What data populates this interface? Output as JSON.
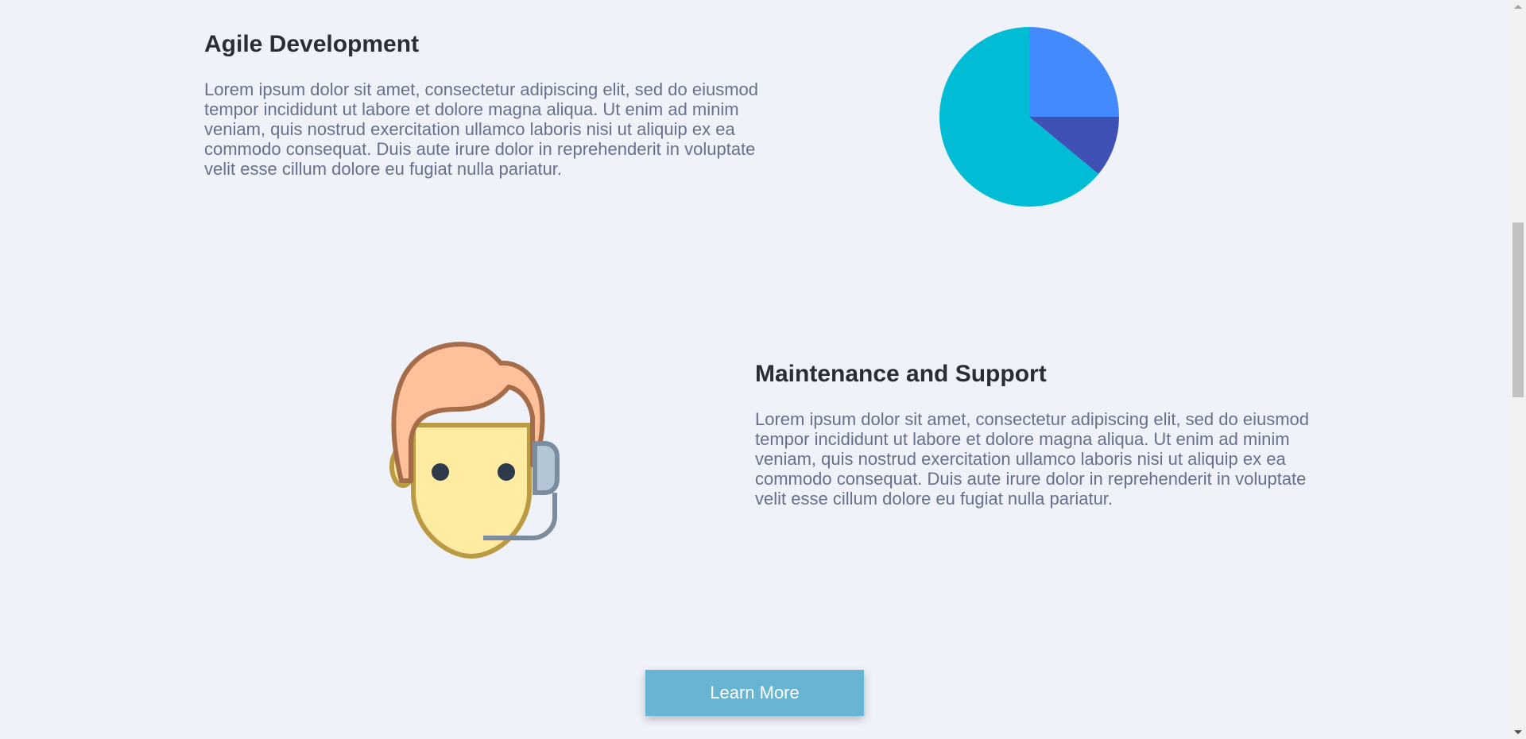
{
  "sections": {
    "agile": {
      "title": "Agile Development",
      "text": "Lorem ipsum dolor sit amet, consectetur adipiscing elit, sed do eiusmod tempor incididunt ut labore et dolore magna aliqua. Ut enim ad minim veniam, quis nostrud exercitation ullamco laboris nisi ut aliquip ex ea commodo consequat. Duis aute irure dolor in reprehenderit in voluptate velit esse cillum dolore eu fugiat nulla pariatur."
    },
    "maintenance": {
      "title": "Maintenance and Support",
      "text": "Lorem ipsum dolor sit amet, consectetur adipiscing elit, sed do eiusmod tempor incididunt ut labore et dolore magna aliqua. Ut enim ad minim veniam, quis nostrud exercitation ullamco laboris nisi ut aliquip ex ea commodo consequat. Duis aute irure dolor in reprehenderit in voluptate velit esse cillum dolore eu fugiat nulla pariatur."
    }
  },
  "button": {
    "learn_more": "Learn More"
  },
  "icons": {
    "support_agent": "support-agent-icon",
    "pie_chart": "pie-chart-icon"
  },
  "colors": {
    "background": "#eff2f9",
    "button": "#67b5d3",
    "heading": "#2a2d34",
    "body_text": "#66708a"
  },
  "chart_data": {
    "type": "pie",
    "values": [
      25,
      11,
      64
    ],
    "colors": [
      "#448aff",
      "#3f51b5",
      "#00bcd4"
    ]
  }
}
